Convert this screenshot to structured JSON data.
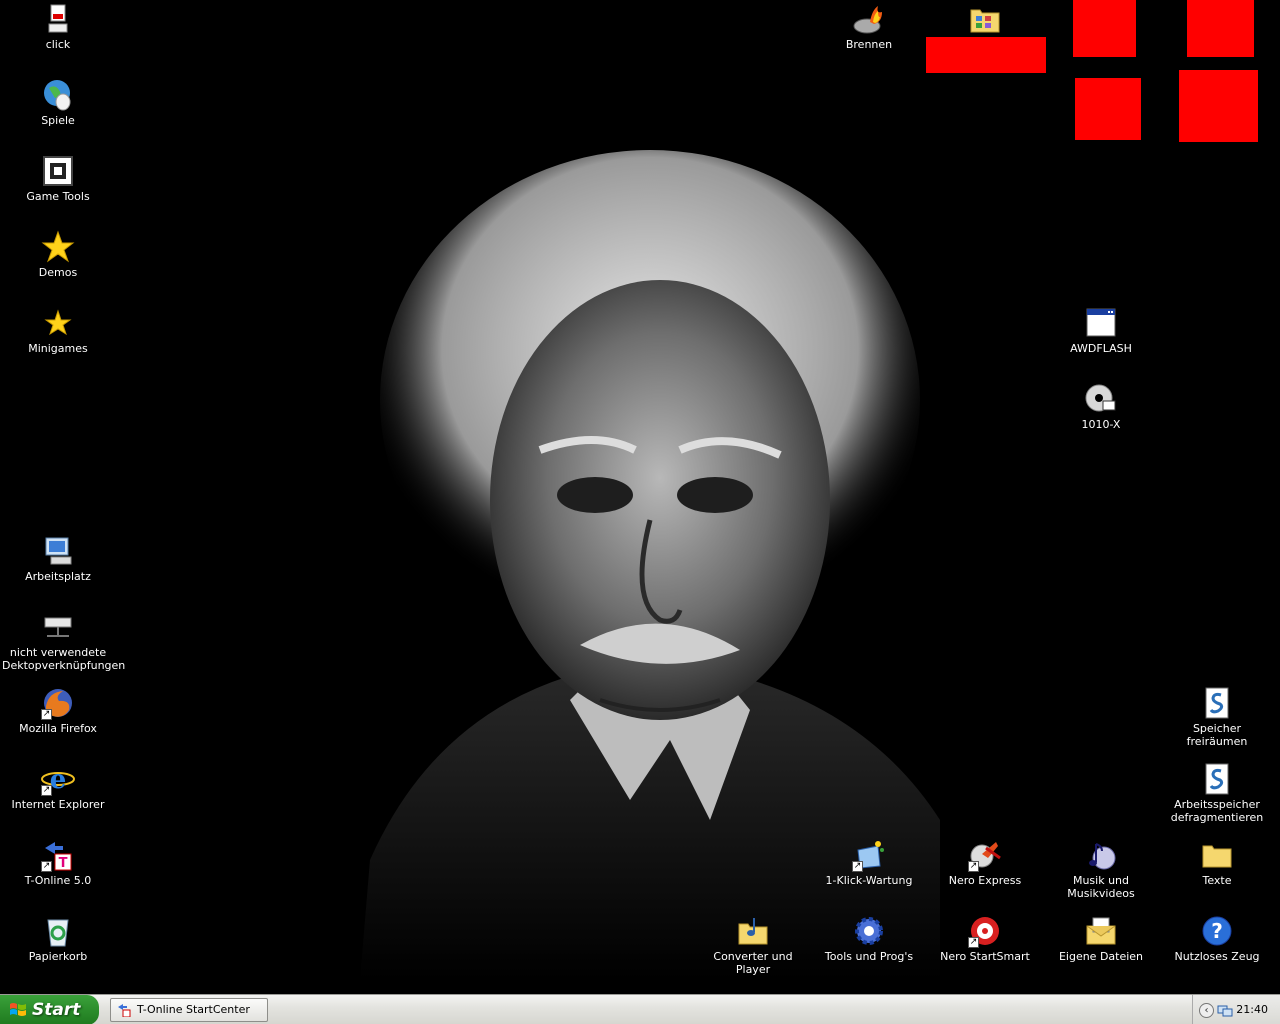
{
  "desktop": {
    "icons_left": [
      {
        "label": "click",
        "icon": "click-icon"
      },
      {
        "label": "Spiele",
        "icon": "globe-mouse-icon"
      },
      {
        "label": "Game Tools",
        "icon": "game-tools-icon"
      },
      {
        "label": "Demos",
        "icon": "star-icon"
      },
      {
        "label": "Minigames",
        "icon": "star-icon"
      },
      {
        "label": "Arbeitsplatz",
        "icon": "my-computer-icon"
      },
      {
        "label": "nicht verwendete Dektopverknüpfungen",
        "icon": "network-drive-icon"
      },
      {
        "label": "Mozilla Firefox",
        "icon": "firefox-icon"
      },
      {
        "label": "Internet Explorer",
        "icon": "internet-explorer-icon"
      },
      {
        "label": "T-Online 5.0",
        "icon": "t-online-icon"
      },
      {
        "label": "Papierkorb",
        "icon": "recycle-bin-icon"
      }
    ],
    "icons_top": [
      {
        "label": "Brennen",
        "icon": "burn-icon"
      },
      {
        "label": "",
        "icon": "folder-programs-icon"
      }
    ],
    "icons_right": [
      {
        "label": "AWDFLASH",
        "icon": "application-window-icon"
      },
      {
        "label": "1010-X",
        "icon": "cd-icon"
      },
      {
        "label": "Speicher freiräumen",
        "icon": "script-icon"
      },
      {
        "label": "Arbeitsspeicher defragmentieren",
        "icon": "script-icon"
      }
    ],
    "icons_bottom_row1": [
      {
        "label": "1-Klick-Wartung",
        "icon": "maintenance-icon"
      },
      {
        "label": "Nero Express",
        "icon": "nero-express-icon"
      },
      {
        "label": "Musik und Musikvideos",
        "icon": "music-icon"
      },
      {
        "label": "Texte",
        "icon": "folder-icon"
      }
    ],
    "icons_bottom_row2": [
      {
        "label": "Converter und Player",
        "icon": "folder-music-icon"
      },
      {
        "label": "Tools und Prog's",
        "icon": "gear-icon"
      },
      {
        "label": "Nero StartSmart",
        "icon": "nero-startsmart-icon"
      },
      {
        "label": "Eigene Dateien",
        "icon": "my-documents-icon"
      },
      {
        "label": "Nutzloses Zeug",
        "icon": "help-icon"
      }
    ]
  },
  "taskbar": {
    "start_label": "Start",
    "open_window": "T-Online StartCenter",
    "clock": "21:40"
  },
  "colors": {
    "desktop_bg": "#000000",
    "red_blocks": "#ff0000",
    "start_green": "#2d8f2d"
  }
}
